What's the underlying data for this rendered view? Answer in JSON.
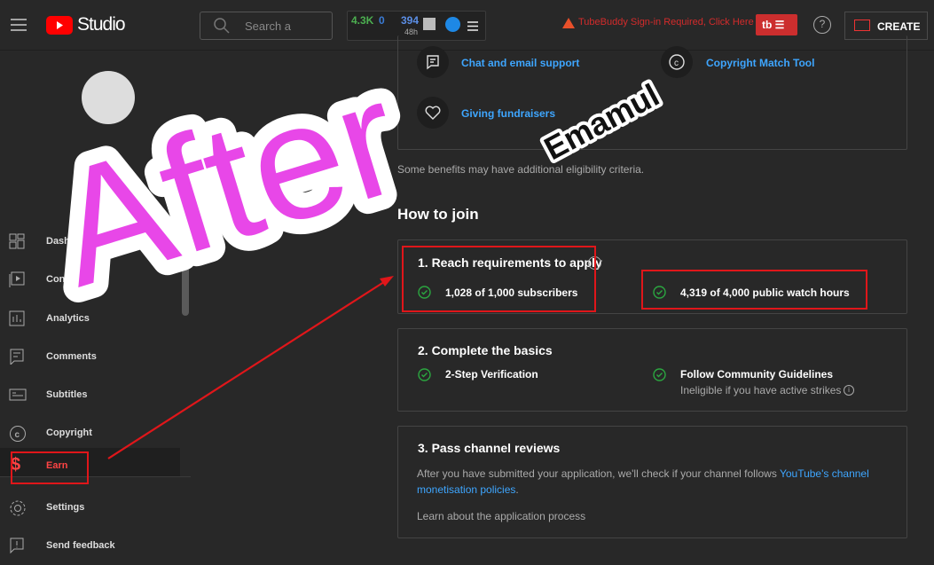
{
  "header": {
    "brand": "Studio",
    "search_placeholder": "Search a",
    "stats": {
      "views": "4.3K",
      "zero": "0",
      "count": "394",
      "period": "48h"
    },
    "warning": "TubeBuddy Sign-in Required, Click Here",
    "tb_label": "tb",
    "create_label": "CREATE"
  },
  "sidebar": {
    "items": [
      {
        "label": "Dashboard"
      },
      {
        "label": "Content"
      },
      {
        "label": "Analytics"
      },
      {
        "label": "Comments"
      },
      {
        "label": "Subtitles"
      },
      {
        "label": "Copyright"
      },
      {
        "label": "Earn"
      },
      {
        "label": "Settings"
      },
      {
        "label": "Send feedback"
      }
    ]
  },
  "benefits": {
    "chat": "Chat and email support",
    "copyright": "Copyright Match Tool",
    "giving": "Giving fundraisers",
    "note": "Some benefits may have additional eligibility criteria."
  },
  "join": {
    "title": "How to join",
    "step1": {
      "title": "1. Reach requirements to apply",
      "subs": "1,028 of 1,000 subscribers",
      "hours": "4,319 of 4,000 public watch hours"
    },
    "step2": {
      "title": "2. Complete the basics",
      "verify": "2-Step Verification",
      "guidelines": "Follow Community Guidelines",
      "strikes": "Ineligible if you have active strikes"
    },
    "step3": {
      "title": "3. Pass channel reviews",
      "text": "After you have submitted your application, we'll check if your channel follows ",
      "link1": "YouTube's channel",
      "link2": "monetisation policies",
      "period": ".",
      "learn": "Learn about the application process"
    }
  },
  "overlay": {
    "after": "After",
    "watermark": "Emamul"
  },
  "colors": {
    "accent": "#3ea6ff",
    "red": "#e0161a",
    "pink": "#e847e8",
    "green": "#2ba640"
  }
}
